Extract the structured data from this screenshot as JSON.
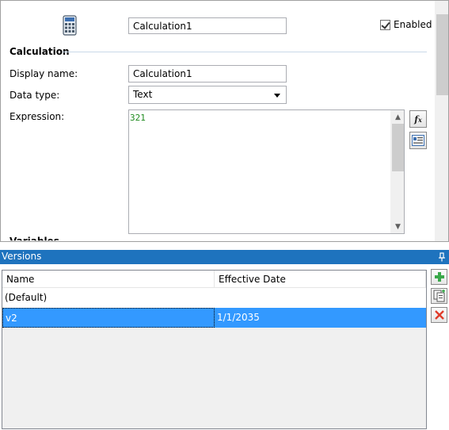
{
  "header": {
    "calc_name": "Calculation1",
    "enabled_label": "Enabled",
    "enabled_checked": true
  },
  "calculation": {
    "section_title": "Calculation",
    "display_name_label": "Display name:",
    "display_name_value": "Calculation1",
    "data_type_label": "Data type:",
    "data_type_value": "Text",
    "expression_label": "Expression:",
    "expression_value": "321",
    "next_section_partial": "Variables"
  },
  "side_buttons": [
    {
      "icon": "function-fx-icon"
    },
    {
      "icon": "field-picker-icon"
    }
  ],
  "versions": {
    "title": "Versions",
    "columns": [
      "Name",
      "Effective Date"
    ],
    "rows": [
      {
        "name": "(Default)",
        "date": "",
        "selected": false
      },
      {
        "name": "v2",
        "date": "1/1/2035",
        "selected": true
      }
    ],
    "toolbar": [
      {
        "icon": "add-plus-icon"
      },
      {
        "icon": "copy-version-icon"
      },
      {
        "icon": "delete-x-icon"
      }
    ]
  },
  "colors": {
    "versions_header_bg": "#1e73be",
    "selected_row_bg": "#3399ff",
    "expression_text": "#1e8a1e"
  }
}
